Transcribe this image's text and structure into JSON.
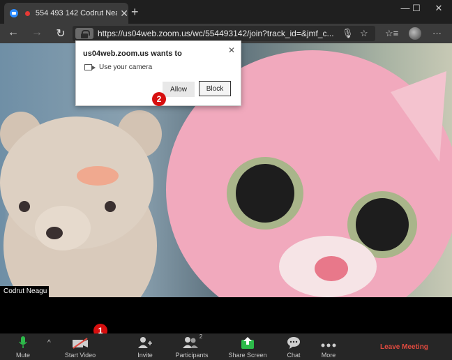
{
  "browser": {
    "tab_title": "554 493 142 Codrut Neagu",
    "tab_close": "✕",
    "new_tab": "+",
    "minimize": "—",
    "maximize": "☐",
    "close": "✕"
  },
  "address_bar": {
    "url": "https://us04web.zoom.us/wc/554493142/join?track_id=&jmf_c...",
    "back": "←",
    "forward": "→",
    "refresh": "↻",
    "mic": "🎙",
    "favorite": "☆",
    "favorites_list": "☆≡",
    "menu": "···"
  },
  "popup": {
    "title": "us04web.zoom.us wants to",
    "permission": "Use your camera",
    "allow_label": "Allow",
    "block_label": "Block",
    "close": "✕"
  },
  "video": {
    "participant_name": "Codrut Neagu"
  },
  "markers": {
    "one": "1",
    "two": "2"
  },
  "toolbar": {
    "mute_label": "Mute",
    "start_video_label": "Start Video",
    "invite_label": "Invite",
    "participants_label": "Participants",
    "participants_count": "2",
    "share_label": "Share Screen",
    "chat_label": "Chat",
    "more_label": "More",
    "leave_label": "Leave Meeting",
    "caret": "^"
  },
  "colors": {
    "leave": "#e04a3f",
    "share": "#2dbb4a",
    "marker": "#d70f0f",
    "mic": "#2dbb4a"
  }
}
